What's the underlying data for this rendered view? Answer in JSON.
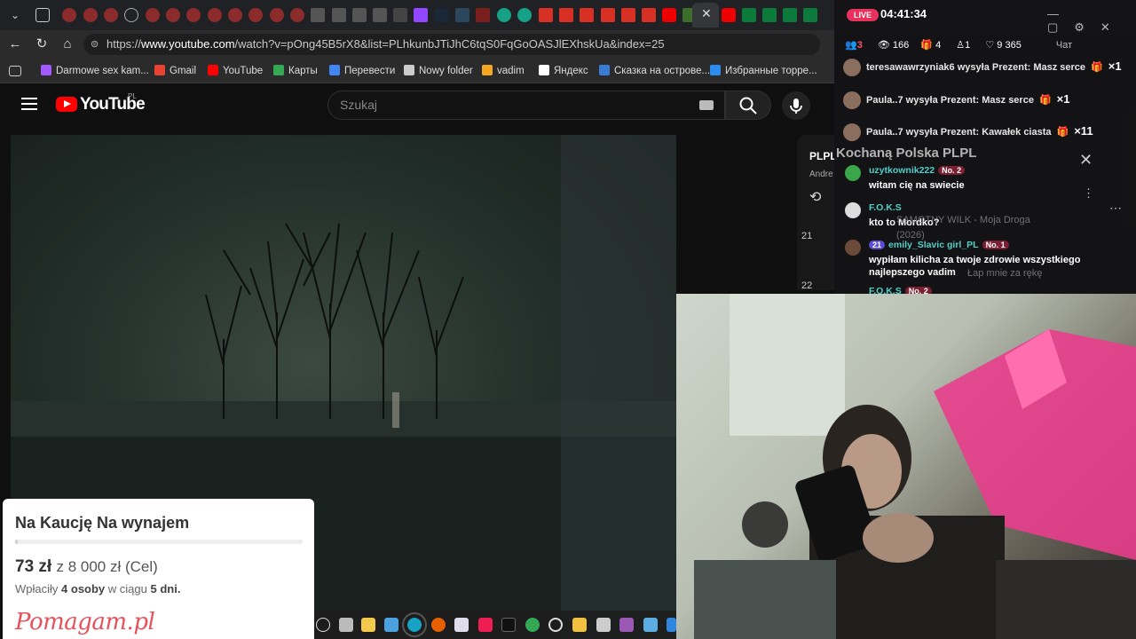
{
  "browser": {
    "url_prefix": "https://",
    "url_host": "www.youtube.com",
    "url_path": "/watch?v=pOng45B5rX8&list=PLhkunbJTiJhC6tqS0FqGoOASJlEXhskUa&index=25",
    "bookmarks": [
      {
        "label": "Darmowe sex kam...",
        "color": "#a259ff"
      },
      {
        "label": "Gmail",
        "color": "#ea4335"
      },
      {
        "label": "YouTube",
        "color": "#ff0000"
      },
      {
        "label": "Карты",
        "color": "#34a853"
      },
      {
        "label": "Перевести",
        "color": "#4285f4"
      },
      {
        "label": "Nowy folder",
        "color": "#cccccc"
      },
      {
        "label": "vadim",
        "color": "#f5a623"
      },
      {
        "label": "Яндекс",
        "color": "#ffffff"
      },
      {
        "label": "Сказка на острове...",
        "color": "#3a7bd5"
      },
      {
        "label": "Избранные торре...",
        "color": "#2d8cf0"
      }
    ]
  },
  "youtube": {
    "logo_text": "YouTube",
    "region": "PL",
    "search_placeholder": "Szukaj",
    "playlist_numbers": [
      "21",
      "22"
    ],
    "playlist_short": "PLPL",
    "channel_short": "Andre"
  },
  "stream": {
    "live_badge": "LIVE",
    "timer": "04:41:34",
    "stats": {
      "notifications": "3",
      "viewers": "166",
      "gifts": "4",
      "followers": "1",
      "likes": "9 365",
      "chat_label": "Чат"
    },
    "gifts": [
      {
        "user": "teresawawrzyniak6",
        "text": "wysyła Prezent: Masz serce",
        "count": "×1"
      },
      {
        "user": "Paula..7",
        "text": "wysyła Prezent: Masz serce",
        "count": "×1"
      },
      {
        "user": "Paula..7",
        "text": "wysyła Prezent: Kawałek ciasta",
        "count": "×11"
      }
    ],
    "room_title": "Kochaną Polska PLPL",
    "comments": [
      {
        "user": "uzytkownik222",
        "badge": "No. 2",
        "text": "witam cię na swiecie",
        "color": "#3aa54a"
      },
      {
        "user": "F.O.K.S",
        "badge": "",
        "text": "kto to Mordko?",
        "color": "#dddddd"
      },
      {
        "user": "emily_Slavic girl_PL",
        "badge": "No. 1",
        "level": "21",
        "text": "wypiłam kilicha za twoje zdrowie wszystkiego najlepszego vadim",
        "color": "#6b4a3a"
      }
    ],
    "overlay_song": "SAMOTNY WILK - Moja Droga",
    "overlay_year": "(2026)",
    "overlay_comment": "Łap mnie za rękę",
    "next_user": "F.O.K.S",
    "next_badge": "No. 2"
  },
  "fundraiser": {
    "title": "Na Kaucję Na wynajem",
    "amount": "73 zł",
    "of_text": "z 8 000 zł (Cel)",
    "donors_pre": "Wpłaciły",
    "donors": "4 osoby",
    "days_pre": "w ciągu",
    "days": "5 dni.",
    "brand": "Pomagam.pl",
    "progress": 0.009
  }
}
